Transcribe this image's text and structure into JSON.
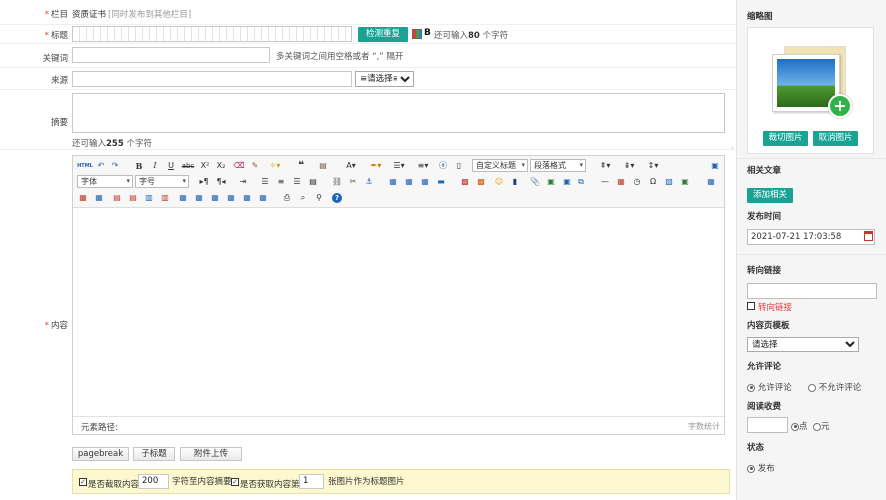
{
  "form": {
    "column": {
      "label": "栏目",
      "value": "资质证书",
      "extra": "[同时发布到其他栏目]"
    },
    "title": {
      "label": "标题",
      "check_button": "检测重复",
      "bold_glyph": "B",
      "hint_prefix": "还可输入",
      "hint_count": "80",
      "hint_suffix": "个字符"
    },
    "keywords": {
      "label": "关键词",
      "hint": "多关键词之间用空格或者 “,” 隔开"
    },
    "source": {
      "label": "来源",
      "select_value": "≡请选择≡"
    },
    "summary": {
      "label": "摘要",
      "hint_prefix": "还可输入",
      "hint_count": "255",
      "hint_suffix": "个字符"
    },
    "content": {
      "label": "内容"
    }
  },
  "editor": {
    "font_select": "字体",
    "size_select": "字号",
    "custom_title_select": "自定义标题",
    "paragraph_select": "段落格式",
    "status_path": "元素路径:",
    "status_count": "字数统计"
  },
  "buttons": {
    "pagebreak": "pagebreak",
    "subtitle": "子标题",
    "attachment": "附件上传"
  },
  "options": {
    "cut_label": "是否截取内容",
    "cut_value": "200",
    "cut_suffix": "字符至内容摘要",
    "thumb_label": "是否获取内容第",
    "thumb_value": "1",
    "thumb_suffix": "张图片作为标题图片"
  },
  "sidebar": {
    "thumbnail_title": "缩略图",
    "crop_button": "裁切图片",
    "cancel_button": "取消图片",
    "related_title": "相关文章",
    "add_related_button": "添加相关",
    "publish_time_title": "发布时间",
    "publish_time_value": "2021-07-21 17:03:58",
    "redirect_title": "转向链接",
    "redirect_checkbox_label": "转向链接",
    "template_title": "内容页模板",
    "template_value": "请选择",
    "comment_title": "允许评论",
    "comment_allow": "允许评论",
    "comment_deny": "不允许评论",
    "fee_title": "阅读收费",
    "fee_point": "点",
    "fee_yuan": "元",
    "status_title": "状态",
    "status_publish": "发布"
  },
  "colors": {
    "accent": "#1aa394",
    "required": "#e53935",
    "warning_bg": "#fdf8d0"
  }
}
